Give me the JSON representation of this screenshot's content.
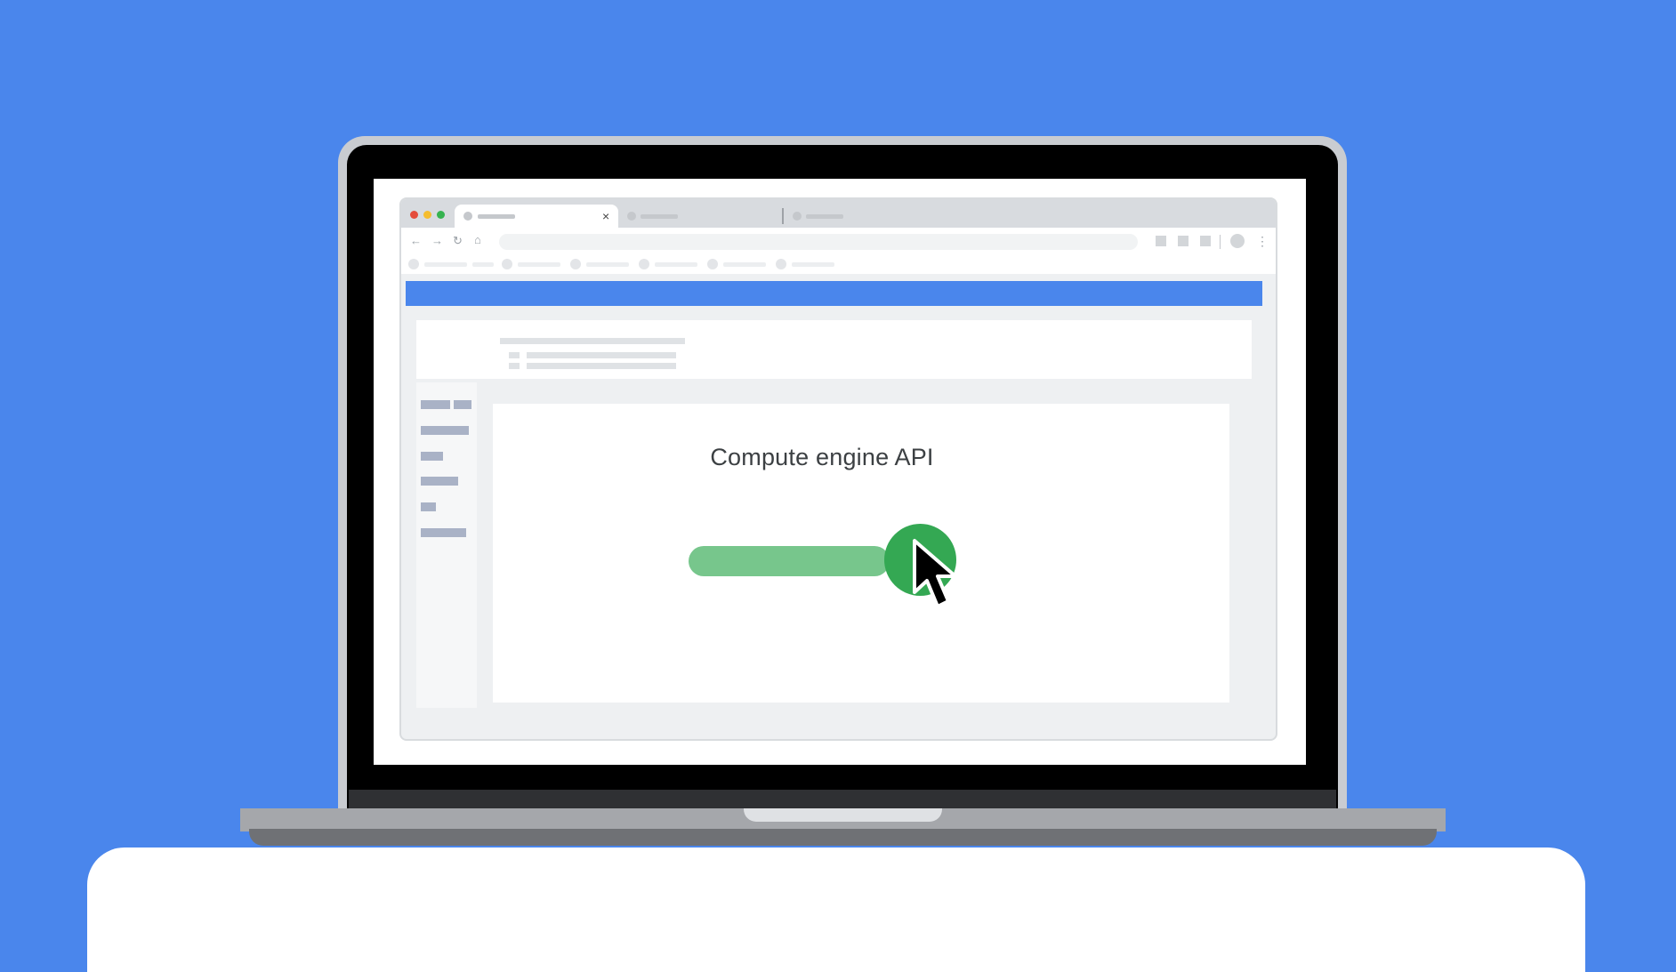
{
  "scene": {
    "background_color": "#4a86ec",
    "desk_color": "#ffffff"
  },
  "browser": {
    "traffic_lights": [
      "#e44c3c",
      "#f5bd2e",
      "#36b350"
    ],
    "tabs": [
      {
        "label": "",
        "active": true,
        "close_icon": "×"
      },
      {
        "label": "",
        "active": false
      },
      {
        "label": "",
        "active": false
      }
    ],
    "toolbar": {
      "back_icon": "←",
      "forward_icon": "→",
      "reload_icon": "↻",
      "home_icon": "⌂",
      "menu_icon": "⋮"
    },
    "accent_color": "#4a86ec"
  },
  "main": {
    "card_title": "Compute engine API",
    "toggle": {
      "state": "on",
      "track_color": "#77c68c",
      "knob_color": "#34a853"
    }
  }
}
